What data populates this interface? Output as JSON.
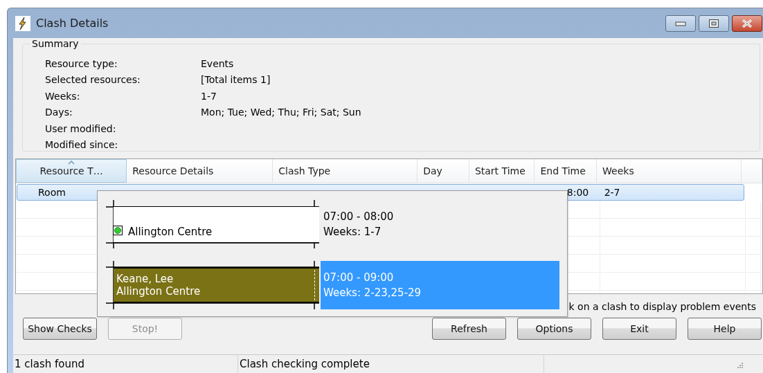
{
  "window": {
    "title": "Clash Details"
  },
  "summary": {
    "title": "Summary",
    "rows": [
      {
        "label": "Resource type:",
        "value": "Events"
      },
      {
        "label": "Selected resources:",
        "value": "[Total items 1]"
      },
      {
        "label": "Weeks:",
        "value": "1-7"
      },
      {
        "label": "Days:",
        "value": "Mon; Tue; Wed; Thu; Fri; Sat; Sun"
      },
      {
        "label": "User modified:",
        "value": null
      },
      {
        "label": "Modified since:",
        "value": null
      }
    ]
  },
  "table": {
    "columns": [
      {
        "label": "Resource T…",
        "sorted": true
      },
      {
        "label": "Resource Details",
        "sorted": false
      },
      {
        "label": "Clash Type",
        "sorted": false
      },
      {
        "label": "Day",
        "sorted": false
      },
      {
        "label": "Start Time",
        "sorted": false
      },
      {
        "label": "End Time",
        "sorted": false
      },
      {
        "label": "Weeks",
        "sorted": false
      }
    ],
    "rows": [
      {
        "selected": true,
        "cells": [
          "Room",
          null,
          null,
          null,
          null,
          "8:00",
          "2-7"
        ]
      }
    ]
  },
  "popup": {
    "entries": [
      {
        "kind": "location",
        "color": "#ffffff",
        "lines": [
          "Allington Centre"
        ],
        "time": "07:00 - 08:00",
        "weeks": "Weeks: 1-7",
        "selected": false
      },
      {
        "kind": "booking",
        "color": "#7b7216",
        "lines": [
          "Keane, Lee",
          "Allington Centre"
        ],
        "time": "07:00 - 09:00",
        "weeks": "Weeks: 2-23,25-29",
        "selected": true
      }
    ]
  },
  "hint": "k on a clash to display problem events",
  "left_buttons": [
    {
      "label": "Show Checks",
      "disabled": false
    },
    {
      "label": "Stop!",
      "disabled": true
    }
  ],
  "right_buttons": [
    {
      "label": "Refresh",
      "disabled": false
    },
    {
      "label": "Options",
      "disabled": false
    },
    {
      "label": "Exit",
      "disabled": false
    },
    {
      "label": "Help",
      "disabled": false
    }
  ],
  "status_bar": [
    "1 clash found",
    "Clash checking complete"
  ]
}
